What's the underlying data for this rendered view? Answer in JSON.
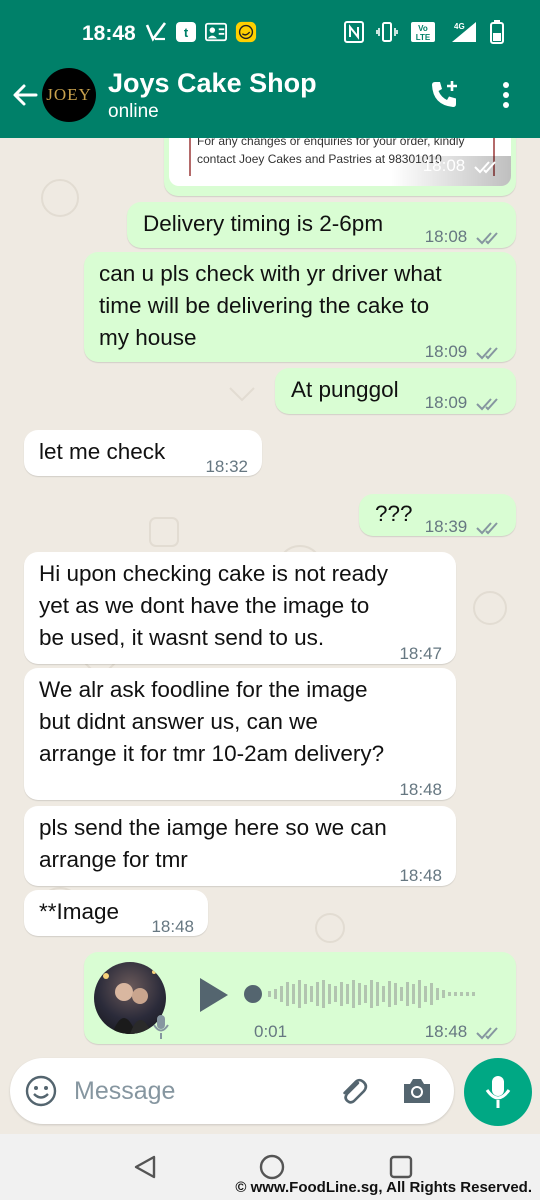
{
  "status_bar": {
    "time": "18:48",
    "network": "4G"
  },
  "header": {
    "title": "Joys Cake Shop",
    "status": "online",
    "avatar_text": "JOEY"
  },
  "messages": [
    {
      "dir": "out",
      "type": "image_tail",
      "text": "For any changes or enquiries for your order, kindly contact Joey Cakes and Pastries at 98301010",
      "time": "18:08"
    },
    {
      "dir": "out",
      "text": "Delivery timing is 2-6pm",
      "time": "18:08"
    },
    {
      "dir": "out",
      "lines": [
        "can u pls check with yr driver what",
        "time will be delivering the cake to",
        "my house"
      ],
      "time": "18:09"
    },
    {
      "dir": "out",
      "text": "At punggol",
      "time": "18:09"
    },
    {
      "dir": "in",
      "text": "let me check",
      "time": "18:32"
    },
    {
      "dir": "out",
      "text": "???",
      "time": "18:39"
    },
    {
      "dir": "in",
      "lines": [
        "Hi upon checking cake is not ready",
        "yet as we dont have the image to",
        "be used, it wasnt send to us."
      ],
      "time": "18:47"
    },
    {
      "dir": "in",
      "lines": [
        "We alr ask foodline for the image",
        "but didnt answer us, can we",
        "arrange it for tmr 10-2am delivery?"
      ],
      "time": "18:48"
    },
    {
      "dir": "in",
      "lines": [
        "pls send the iamge here so we can",
        "arrange for tmr"
      ],
      "time": "18:48"
    },
    {
      "dir": "in",
      "text": "**Image",
      "time": "18:48"
    },
    {
      "dir": "out",
      "type": "voice",
      "duration": "0:01",
      "time": "18:48"
    }
  ],
  "composer": {
    "placeholder": "Message"
  },
  "footer": "© www.FoodLine.sg, All Rights Reserved.",
  "colors": {
    "header": "#008069",
    "outgoing": "#d9fdd3",
    "incoming": "#ffffff",
    "accent": "#00a884",
    "background": "#efeae2",
    "ticks": "#8696a0"
  }
}
